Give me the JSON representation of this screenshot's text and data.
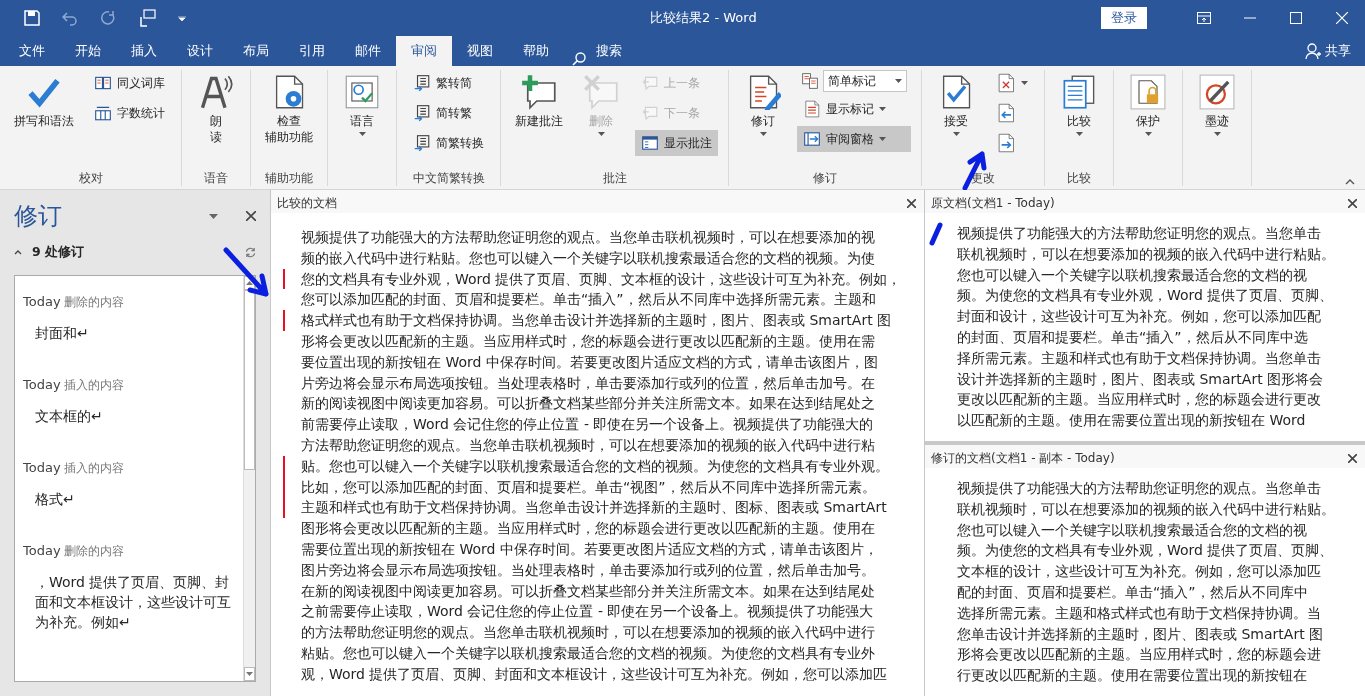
{
  "title_bar": {
    "title": "比较结果2 - Word",
    "sign_in": "登录"
  },
  "tabs": [
    {
      "label": "文件",
      "selected": false
    },
    {
      "label": "开始",
      "selected": false
    },
    {
      "label": "插入",
      "selected": false
    },
    {
      "label": "设计",
      "selected": false
    },
    {
      "label": "布局",
      "selected": false
    },
    {
      "label": "引用",
      "selected": false
    },
    {
      "label": "邮件",
      "selected": false
    },
    {
      "label": "审阅",
      "selected": true
    },
    {
      "label": "视图",
      "selected": false
    },
    {
      "label": "帮助",
      "selected": false
    }
  ],
  "tell_me": "搜索",
  "share": "共享",
  "ribbon": {
    "groups": [
      {
        "label": "校对",
        "columns": [
          [
            {
              "kind": "large",
              "label": "拼写和语法",
              "dropdown": false,
              "disabled": false,
              "selected": false
            }
          ],
          [
            {
              "kind": "small",
              "label": "同义词库",
              "dropdown": false,
              "disabled": false,
              "selected": false
            },
            {
              "kind": "small",
              "label": "字数统计",
              "dropdown": false,
              "disabled": false,
              "selected": false
            }
          ]
        ]
      },
      {
        "label": "语音",
        "columns": [
          [
            {
              "kind": "large",
              "label": [
                "朗",
                "读"
              ],
              "dropdown": false,
              "disabled": false,
              "selected": false
            }
          ]
        ]
      },
      {
        "label": "辅助功能",
        "columns": [
          [
            {
              "kind": "large",
              "label": [
                "检查",
                "辅助功能"
              ],
              "dropdown": false,
              "disabled": false,
              "selected": false
            }
          ]
        ]
      },
      {
        "columns": [
          [
            {
              "kind": "large",
              "label": "语言",
              "dropdown": true,
              "disabled": false,
              "selected": false
            }
          ]
        ]
      },
      {
        "label": "中文简繁转换",
        "columns": [
          [
            {
              "kind": "small",
              "label": "繁转简",
              "dropdown": false,
              "disabled": false,
              "selected": false
            },
            {
              "kind": "small",
              "label": "简转繁",
              "dropdown": false,
              "disabled": false,
              "selected": false
            },
            {
              "kind": "small",
              "label": "简繁转换",
              "dropdown": false,
              "disabled": false,
              "selected": false
            }
          ]
        ]
      },
      {
        "label": "批注",
        "columns": [
          [
            {
              "kind": "large",
              "label": "新建批注",
              "dropdown": false,
              "disabled": false,
              "selected": false
            }
          ],
          [
            {
              "kind": "large",
              "label": "删除",
              "dropdown": true,
              "disabled": true,
              "selected": false
            }
          ],
          [
            {
              "kind": "small",
              "label": "上一条",
              "dropdown": false,
              "disabled": true,
              "selected": false
            },
            {
              "kind": "small",
              "label": "下一条",
              "dropdown": false,
              "disabled": true,
              "selected": false
            },
            {
              "kind": "small",
              "label": "显示批注",
              "dropdown": false,
              "disabled": false,
              "selected": true
            }
          ]
        ]
      },
      {
        "label": "修订",
        "columns": [
          [
            {
              "kind": "large",
              "label": "修订",
              "dropdown": true,
              "disabled": false,
              "selected": false
            }
          ],
          [
            {
              "kind": "combo",
              "label": "简单标记",
              "dropdown": true,
              "disabled": false,
              "selected": false
            },
            {
              "kind": "small",
              "label": "显示标记",
              "dropdown": true,
              "disabled": false,
              "selected": false
            },
            {
              "kind": "small",
              "label": "审阅窗格",
              "dropdown": true,
              "disabled": false,
              "selected": true
            }
          ]
        ]
      },
      {
        "label": "更改",
        "columns": [
          [
            {
              "kind": "large",
              "label": "接受",
              "dropdown": true,
              "disabled": false,
              "selected": false
            }
          ],
          [
            {
              "kind": "icon",
              "dropdown": true,
              "disabled": false,
              "selected": false
            },
            {
              "kind": "icon",
              "dropdown": false,
              "disabled": false,
              "selected": false
            },
            {
              "kind": "icon",
              "dropdown": false,
              "disabled": false,
              "selected": false
            }
          ]
        ]
      },
      {
        "label": "比较",
        "columns": [
          [
            {
              "kind": "large",
              "label": "比较",
              "dropdown": true,
              "disabled": false,
              "selected": false
            }
          ]
        ]
      },
      {
        "columns": [
          [
            {
              "kind": "large",
              "label": "保护",
              "dropdown": true,
              "disabled": false,
              "selected": false
            }
          ]
        ]
      },
      {
        "columns": [
          [
            {
              "kind": "large",
              "label": "墨迹",
              "dropdown": true,
              "disabled": false,
              "selected": false
            }
          ]
        ]
      }
    ]
  },
  "revisions_pane": {
    "title": "修订",
    "summary": "9 处修订",
    "items": [
      {
        "author": "Today",
        "type": "删除的内容",
        "text": "封面和↵"
      },
      {
        "author": "Today",
        "type": "插入的内容",
        "text": "文本框的↵"
      },
      {
        "author": "Today",
        "type": "插入的内容",
        "text": "格式↵"
      },
      {
        "author": "Today",
        "type": "删除的内容",
        "text": "，Word 提供了页眉、页脚、封面和文本框设计，这些设计可互为补充。例如↵"
      }
    ]
  },
  "document": {
    "title": "比较的文档",
    "lines": [
      {
        "text": "视频提供了功能强大的方法帮助您证明您的观点。当您单击联机视频时，可以在想要添加的视",
        "changed": false
      },
      {
        "text": "频的嵌入代码中进行粘贴。您也可以键入一个关键字以联机搜索最适合您的文档的视频。为使",
        "changed": false
      },
      {
        "text": "您的文档具有专业外观，Word 提供了页眉、页脚、文本框的设计，这些设计可互为补充。例如，",
        "changed": true
      },
      {
        "text": "您可以添加匹配的封面、页眉和提要栏。单击“插入”，然后从不同库中选择所需元素。主题和",
        "changed": false
      },
      {
        "text": "格式样式也有助于文档保持协调。当您单击设计并选择新的主题时，图片、图表或 SmartArt 图",
        "changed": true
      },
      {
        "text": "形将会更改以匹配新的主题。当应用样式时，您的标题会进行更改以匹配新的主题。使用在需",
        "changed": false
      },
      {
        "text": "要位置出现的新按钮在 Word 中保存时间。若要更改图片适应文档的方式，请单击该图片，图",
        "changed": false
      },
      {
        "text": "片旁边将会显示布局选项按钮。当处理表格时，单击要添加行或列的位置，然后单击加号。在",
        "changed": false
      },
      {
        "text": "新的阅读视图中阅读更加容易。可以折叠文档某些部分并关注所需文本。如果在达到结尾处之",
        "changed": false
      },
      {
        "text": "前需要停止读取，Word 会记住您的停止位置 - 即使在另一个设备上。视频提供了功能强大的",
        "changed": false
      },
      {
        "text": "方法帮助您证明您的观点。当您单击联机视频时，可以在想要添加的视频的嵌入代码中进行粘",
        "changed": false
      },
      {
        "text": "贴。您也可以键入一个关键字以联机搜索最适合您的文档的视频。为使您的文档具有专业外观。",
        "changed": true
      },
      {
        "text": "比如，您可以添加匹配的封面、页眉和提要栏。单击“视图”，然后从不同库中选择所需元素。",
        "changed": true
      },
      {
        "text": "主题和样式也有助于文档保持协调。当您单击设计并选择新的主题时、图标、图表或 SmartArt",
        "changed": true
      },
      {
        "text": "图形将会更改以匹配新的主题。当应用样式时，您的标题会进行更改以匹配新的主题。使用在",
        "changed": false
      },
      {
        "text": "需要位置出现的新按钮在 Word 中保存时间。若要更改图片适应文档的方式，请单击该图片，",
        "changed": false
      },
      {
        "text": "图片旁边将会显示布局选项按钮。当处理表格时，单击要添加行或列的位置，然后单击加号。",
        "changed": false
      },
      {
        "text": "在新的阅读视图中阅读更加容易。可以折叠文档某些部分并关注所需文本。如果在达到结尾处",
        "changed": false
      },
      {
        "text": "之前需要停止读取，Word 会记住您的停止位置 - 即使在另一个设备上。视频提供了功能强大",
        "changed": false
      },
      {
        "text": "的方法帮助您证明您的观点。当您单击联机视频时，可以在想要添加的视频的嵌入代码中进行",
        "changed": false
      },
      {
        "text": "粘贴。您也可以键入一个关键字以联机搜索最适合您的文档的视频。为使您的文档具有专业外",
        "changed": false
      },
      {
        "text": "观，Word 提供了页眉、页脚、封面和文本框设计，这些设计可互为补充。例如，您可以添加匹",
        "changed": false
      }
    ]
  },
  "source_panes": [
    {
      "title": "原文档(文档1 - Today)",
      "lines": [
        "视频提供了功能强大的方法帮助您证明您的观点。当您单击",
        "联机视频时，可以在想要添加的视频的嵌入代码中进行粘贴。",
        "您也可以键入一个关键字以联机搜索最适合您的文档的视",
        "频。为使您的文档具有专业外观，Word 提供了页眉、页脚、",
        "封面和设计，这些设计可互为补充。例如，您可以添加匹配",
        "的封面、页眉和提要栏。单击“插入”，然后从不同库中选",
        "择所需元素。主题和样式也有助于文档保持协调。当您单击",
        "设计并选择新的主题时，图片、图表或 SmartArt 图形将会",
        "更改以匹配新的主题。当应用样式时，您的标题会进行更改",
        "以匹配新的主题。使用在需要位置出现的新按钮在 Word"
      ]
    },
    {
      "title": "修订的文档(文档1 - 副本 - Today)",
      "lines": [
        "视频提供了功能强大的方法帮助您证明您的观点。当您单击",
        "联机视频时，可以在想要添加的视频的嵌入代码中进行粘贴。",
        "您也可以键入一个关键字以联机搜索最适合您的文档的视",
        "频。为使您的文档具有专业外观，Word 提供了页眉、页脚、",
        "文本框的设计，这些设计可互为补充。例如，您可以添加匹",
        "配的封面、页眉和提要栏。单击“插入”，然后从不同库中",
        "选择所需元素。主题和格式样式也有助于文档保持协调。当",
        "您单击设计并选择新的主题时，图片、图表或 SmartArt 图",
        "形将会更改以匹配新的主题。当应用样式时，您的标题会进",
        "行更改以匹配新的主题。使用在需要位置出现的新按钮在"
      ]
    }
  ]
}
